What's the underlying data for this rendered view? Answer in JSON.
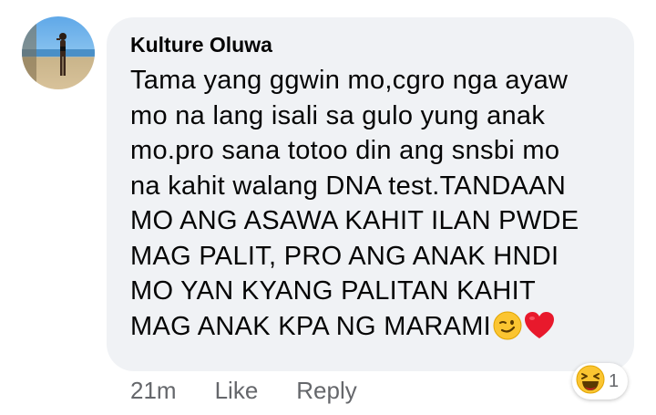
{
  "comment": {
    "author": "Kulture Oluwa",
    "avatar_icon": "profile-photo",
    "lines": [
      "Tama yang ggwin mo,cgro nga ayaw",
      "mo na lang isali sa gulo yung anak",
      "mo.pro sana totoo din ang snsbi mo",
      "na kahit walang DNA test.TANDAAN",
      "MO ANG ASAWA KAHIT ILAN PWDE",
      "MAG PALIT, PRO ANG ANAK HNDI",
      "MO YAN KYANG PALITAN KAHIT",
      "MAG ANAK KPA NG MARAMI"
    ],
    "trailing_emojis": [
      "smirk-emoji",
      "red-heart-emoji"
    ]
  },
  "actions": {
    "time": "21m",
    "like_label": "Like",
    "reply_label": "Reply"
  },
  "reactions": {
    "icon": "haha-reaction-icon",
    "count": "1"
  },
  "colors": {
    "bubble": "#f0f2f5",
    "text": "#050505",
    "secondary_text": "#65676b"
  }
}
